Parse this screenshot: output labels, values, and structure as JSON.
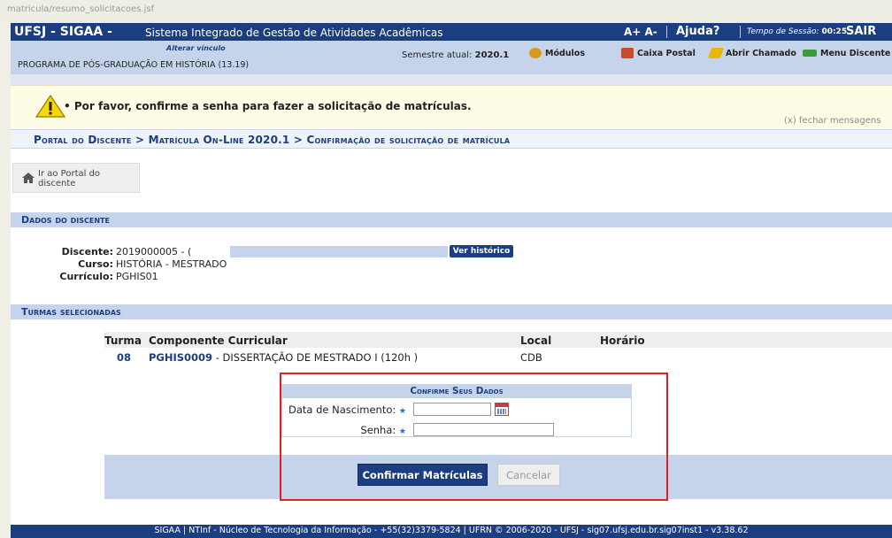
{
  "browser": {
    "url_fragment": "matricula/resumo_solicitacoes.jsf"
  },
  "header": {
    "brand": "UFSJ - SIGAA -",
    "system_name": "Sistema Integrado de Gestão de Atividades Acadêmicas",
    "font_size_controls": "A+ A-",
    "help": "Ajuda?",
    "session_label": "Tempo de Sessão:",
    "session_time": "00:25",
    "logout": "SAIR"
  },
  "info": {
    "alter_link": "Alterar vínculo",
    "program": "PROGRAMA DE PÓS-GRADUAÇÃO EM HISTÓRIA (13.19)",
    "semester_label": "Semestre atual:",
    "semester": "2020.1",
    "modules": [
      {
        "label": "Módulos",
        "icon": "modules-icon"
      },
      {
        "label": "Caixa Postal",
        "icon": "mailbox-icon"
      },
      {
        "label": "Abrir Chamado",
        "icon": "ticket-icon"
      },
      {
        "label": "Menu Discente",
        "icon": "menu-icon"
      }
    ]
  },
  "message": {
    "text": "• Por favor, confirme a senha para fazer a solicitação de matrículas.",
    "close": "(x) fechar mensagens"
  },
  "breadcrumb": "Portal do Discente > Matrícula On-Line 2020.1 > Confirmação de solicitação de matrícula",
  "portal_button": "Ir ao Portal do discente",
  "student": {
    "section_title": "Dados do discente",
    "discente_label": "Discente:",
    "discente_value": "2019000005 - (",
    "history_button": "Ver histórico",
    "curso_label": "Curso:",
    "curso_value": "HISTÓRIA - MESTRADO",
    "curriculo_label": "Currículo:",
    "curriculo_value": "PGHIS01"
  },
  "classes": {
    "section_title": "Turmas selecionadas",
    "columns": [
      "Turma",
      "Componente Curricular",
      "Local",
      "Horário"
    ],
    "rows": [
      {
        "turma": "08",
        "code": "PGHIS0009",
        "name": " - DISSERTAÇÃO DE MESTRADO I (120h )",
        "local": "CDB",
        "horario": ""
      }
    ]
  },
  "confirm": {
    "title": "Confirme Seus Dados",
    "birth_label": "Data de Nascimento:",
    "birth_value": "",
    "password_label": "Senha:",
    "password_value": "",
    "confirm_button": "Confirmar Matrículas",
    "cancel_button": "Cancelar"
  },
  "footer": "SIGAA | NTInf - Núcleo de Tecnologia da Informação - +55(32)3379-5824 | UFRN © 2006-2020 - UFSJ - sig07.ufsj.edu.br.sig07inst1 - v3.38.62",
  "colors": {
    "primary": "#1b3e80",
    "light": "#c6d4eb",
    "highlight": "#e02020",
    "warning": "#f5d800"
  }
}
